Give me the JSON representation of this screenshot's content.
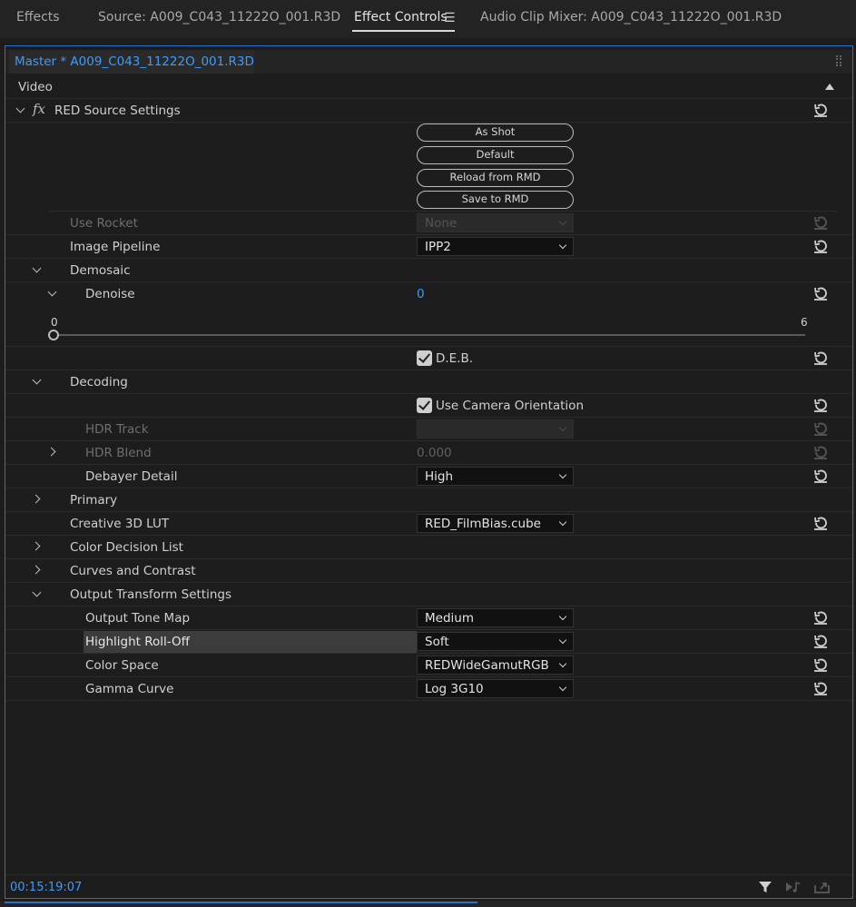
{
  "tabs": [
    {
      "label": "Effects",
      "active": false
    },
    {
      "label": "Source: A009_C043_11222O_001.R3D",
      "active": false
    },
    {
      "label": "Effect Controls",
      "active": true
    },
    {
      "label": "Audio Clip Mixer: A009_C043_11222O_001.R3D",
      "active": false
    }
  ],
  "menu_icon": "hamburger-menu-icon",
  "master_label": "Master * A009_C043_11222O_001.R3D",
  "section_video": "Video",
  "effect_name": "RED Source Settings",
  "effect_icon": "fx-icon",
  "buttons": {
    "as_shot": "As Shot",
    "default": "Default",
    "reload": "Reload from RMD",
    "save": "Save to RMD"
  },
  "use_rocket": {
    "label": "Use Rocket",
    "value": "None"
  },
  "image_pipeline": {
    "label": "Image Pipeline",
    "value": "IPP2"
  },
  "demosaic": {
    "label": "Demosaic"
  },
  "denoise": {
    "label": "Denoise",
    "value": "0",
    "min": "0",
    "max": "6",
    "slider_value": 0
  },
  "deb": {
    "label": "D.E.B.",
    "checked": true
  },
  "decoding": {
    "label": "Decoding"
  },
  "use_camera_orientation": {
    "label": "Use Camera Orientation",
    "checked": true
  },
  "hdr_track": {
    "label": "HDR Track",
    "value": ""
  },
  "hdr_blend": {
    "label": "HDR Blend",
    "value": "0.000"
  },
  "debayer_detail": {
    "label": "Debayer Detail",
    "value": "High"
  },
  "primary": {
    "label": "Primary"
  },
  "creative_lut": {
    "label": "Creative 3D LUT",
    "value": "RED_FilmBias.cube"
  },
  "cdl": {
    "label": "Color Decision List"
  },
  "curves": {
    "label": "Curves and Contrast"
  },
  "output_transform": {
    "label": "Output Transform Settings"
  },
  "output_tone_map": {
    "label": "Output Tone Map",
    "value": "Medium"
  },
  "highlight_rolloff": {
    "label": "Highlight Roll-Off",
    "value": "Soft"
  },
  "color_space": {
    "label": "Color Space",
    "value": "REDWideGamutRGB"
  },
  "gamma_curve": {
    "label": "Gamma Curve",
    "value": "Log 3G10"
  },
  "footer": {
    "timecode": "00:15:19:07",
    "icons": [
      "filter-icon",
      "play-audio-icon",
      "export-icon"
    ]
  },
  "colors": {
    "accent": "#3d9bff",
    "panel_border": "#2a71c7"
  }
}
